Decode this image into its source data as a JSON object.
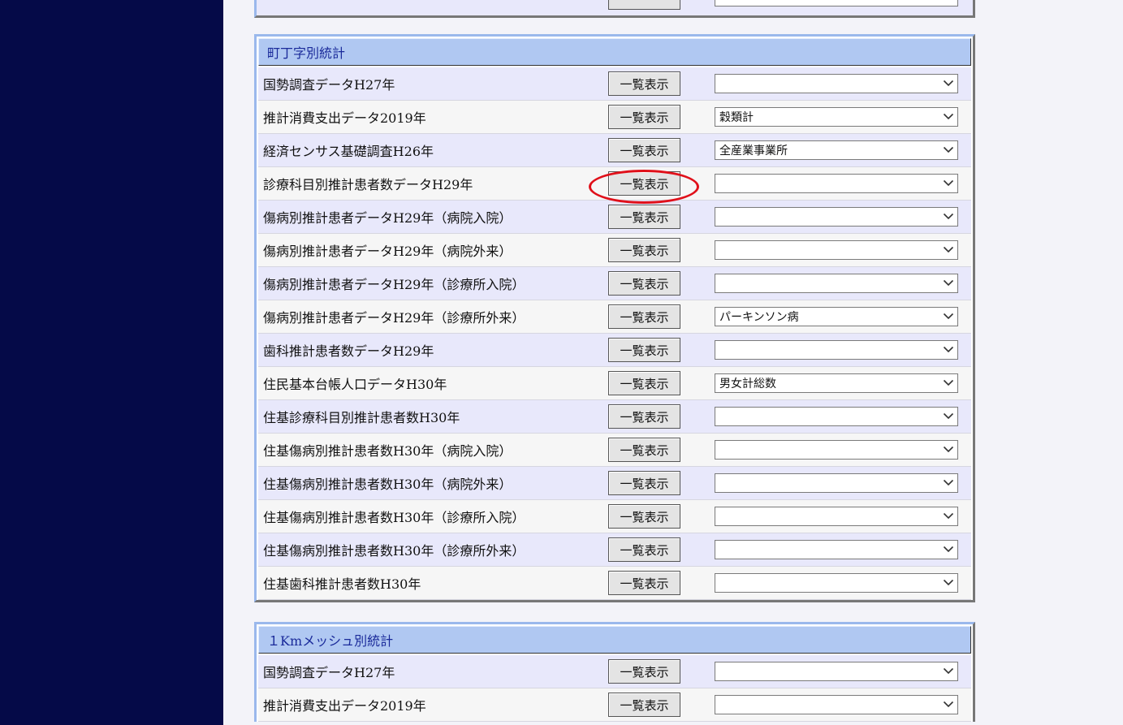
{
  "button_label": "一覧表示",
  "sections": [
    {
      "title": "町丁字別統計",
      "rows": [
        {
          "label": "国勢調査データH27年",
          "select_value": ""
        },
        {
          "label": "推計消費支出データ2019年",
          "select_value": "穀類計"
        },
        {
          "label": "経済センサス基礎調査H26年",
          "select_value": "全産業事業所"
        },
        {
          "label": "診療科目別推計患者数データH29年",
          "select_value": ""
        },
        {
          "label": "傷病別推計患者データH29年（病院入院）",
          "select_value": ""
        },
        {
          "label": "傷病別推計患者データH29年（病院外来）",
          "select_value": ""
        },
        {
          "label": "傷病別推計患者データH29年（診療所入院）",
          "select_value": ""
        },
        {
          "label": "傷病別推計患者データH29年（診療所外来）",
          "select_value": "パーキンソン病"
        },
        {
          "label": "歯科推計患者数データH29年",
          "select_value": ""
        },
        {
          "label": "住民基本台帳人口データH30年",
          "select_value": "男女計総数"
        },
        {
          "label": "住基診療科目別推計患者数H30年",
          "select_value": ""
        },
        {
          "label": "住基傷病別推計患者数H30年（病院入院）",
          "select_value": ""
        },
        {
          "label": "住基傷病別推計患者数H30年（病院外来）",
          "select_value": ""
        },
        {
          "label": "住基傷病別推計患者数H30年（診療所入院）",
          "select_value": ""
        },
        {
          "label": "住基傷病別推計患者数H30年（診療所外来）",
          "select_value": ""
        },
        {
          "label": "住基歯科推計患者数H30年",
          "select_value": ""
        }
      ]
    },
    {
      "title": "１Kmメッシュ別統計",
      "rows": [
        {
          "label": "国勢調査データH27年",
          "select_value": ""
        },
        {
          "label": "推計消費支出データ2019年",
          "select_value": ""
        }
      ]
    }
  ],
  "highlight": {
    "color": "#e0101a"
  },
  "icons": {
    "select_arrow": "chevron-down-icon"
  }
}
